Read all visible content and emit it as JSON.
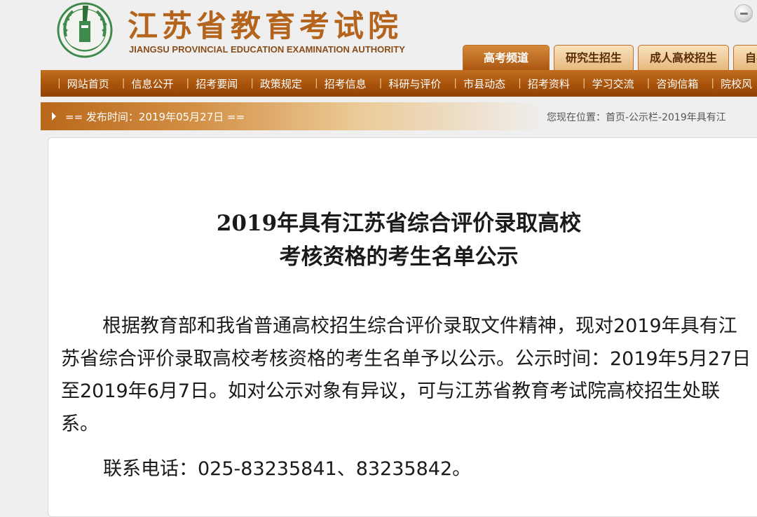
{
  "header": {
    "site_title": "江苏省教育考试院",
    "site_subtitle": "JIANGSU PROVINCIAL EDUCATION EXAMINATION AUTHORITY",
    "logo_icon": "school-seal-logo-icon",
    "tabs": [
      {
        "label": "高考频道",
        "active": true
      },
      {
        "label": "研究生招生",
        "active": false
      },
      {
        "label": "成人高校招生",
        "active": false
      },
      {
        "label": "自学",
        "active": false
      }
    ]
  },
  "nav": {
    "items": [
      "网站首页",
      "信息公开",
      "招考要闻",
      "政策规定",
      "招考信息",
      "科研与评价",
      "市县动态",
      "招考资料",
      "学习交流",
      "咨询信箱",
      "院校风"
    ]
  },
  "datebar": {
    "publish_text": "== 发布时间：2019年05月27日 ==",
    "breadcrumb": "您现在位置：首页-公示栏-2019年具有江"
  },
  "article": {
    "title_line1": "2019年具有江苏省综合评价录取高校",
    "title_line2": "考核资格的考生名单公示",
    "paragraph1": "根据教育部和我省普通高校招生综合评价录取文件精神，现对2019年具有江苏省综合评价录取高校考核资格的考生名单予以公示。公示时间：2019年5月27日至2019年6月7日。如对公示对象有异议，可与江苏省教育考试院高校招生处联系。",
    "paragraph2": "联系电话：025-83235841、83235842。"
  },
  "colors": {
    "brand_orange": "#b4641c",
    "nav_brown": "#a8530b",
    "tab_active": "#ac5611"
  }
}
